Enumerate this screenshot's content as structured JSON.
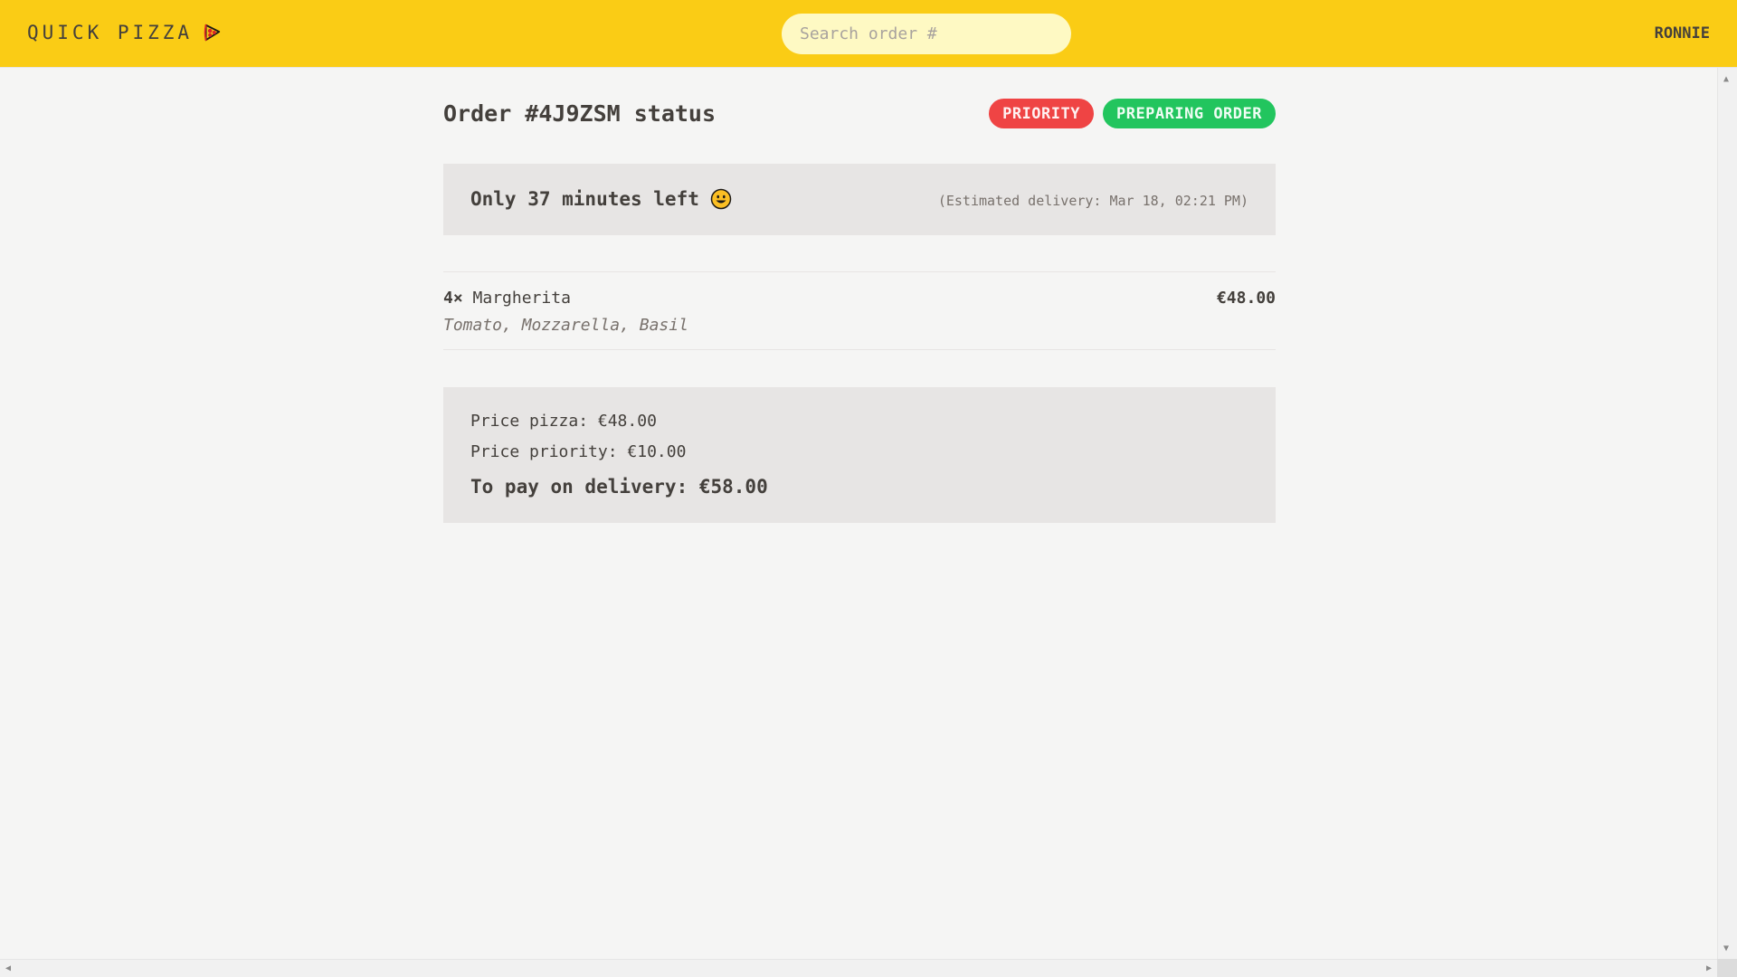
{
  "header": {
    "logo_text": "QUICK PIZZA",
    "search_placeholder": "Search order #",
    "search_value": "",
    "username": "RONNIE"
  },
  "order": {
    "title": "Order #4J9ZSM status",
    "badges": {
      "priority": "PRIORITY",
      "status": "PREPARING ORDER"
    },
    "countdown": {
      "text": "Only 37 minutes left",
      "estimated": "(Estimated delivery: Mar 18, 02:21 PM)"
    },
    "items": [
      {
        "quantity": "4×",
        "name": "Margherita",
        "price": "€48.00",
        "ingredients": "Tomato, Mozzarella, Basil"
      }
    ],
    "summary": {
      "price_pizza": "Price pizza: €48.00",
      "price_priority": "Price priority: €10.00",
      "to_pay": "To pay on delivery: €58.00"
    }
  },
  "colors": {
    "header_bg": "#facc15",
    "priority_badge": "#ef4444",
    "status_badge": "#22c55e",
    "panel_bg": "#e7e5e4",
    "page_bg": "#f5f5f4"
  },
  "icons": {
    "logo": "pizza-slice-icon",
    "countdown": "smiling-face-emoji"
  }
}
